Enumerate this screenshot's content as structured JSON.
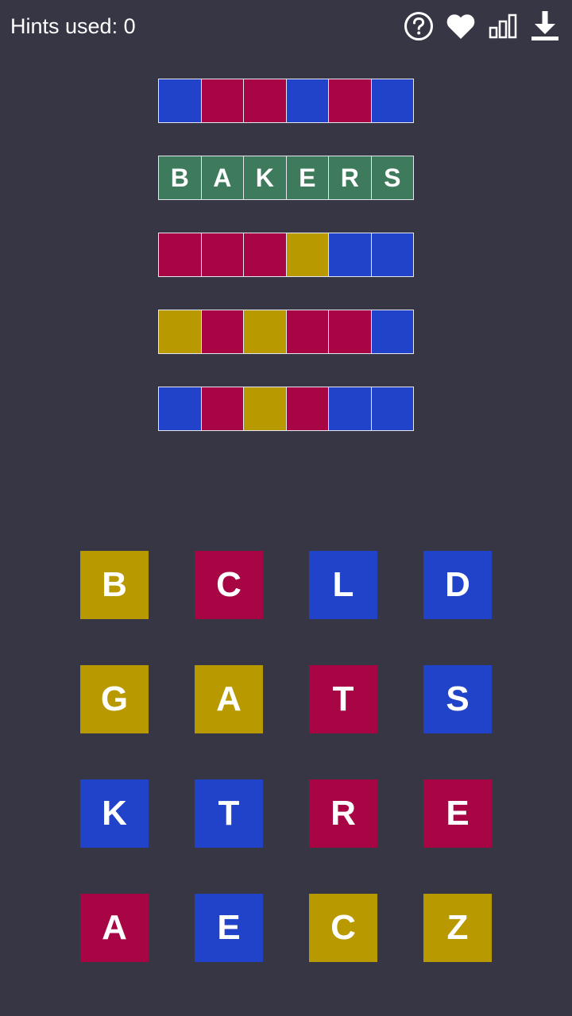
{
  "header": {
    "hints_label": "Hints used: 0",
    "icons": [
      "help-icon",
      "heart-icon",
      "stats-icon",
      "download-icon"
    ]
  },
  "colors": {
    "background": "#373645",
    "blue": "#2143c9",
    "red": "#a80545",
    "yellow": "#b89a00",
    "green": "#3e7b5d"
  },
  "guess_rows": [
    {
      "cells": [
        {
          "letter": "",
          "color": "blue"
        },
        {
          "letter": "",
          "color": "red"
        },
        {
          "letter": "",
          "color": "red"
        },
        {
          "letter": "",
          "color": "blue"
        },
        {
          "letter": "",
          "color": "red"
        },
        {
          "letter": "",
          "color": "blue"
        }
      ]
    },
    {
      "cells": [
        {
          "letter": "B",
          "color": "green"
        },
        {
          "letter": "A",
          "color": "green"
        },
        {
          "letter": "K",
          "color": "green"
        },
        {
          "letter": "E",
          "color": "green"
        },
        {
          "letter": "R",
          "color": "green"
        },
        {
          "letter": "S",
          "color": "green"
        }
      ]
    },
    {
      "cells": [
        {
          "letter": "",
          "color": "red"
        },
        {
          "letter": "",
          "color": "red"
        },
        {
          "letter": "",
          "color": "red"
        },
        {
          "letter": "",
          "color": "yellow"
        },
        {
          "letter": "",
          "color": "blue"
        },
        {
          "letter": "",
          "color": "blue"
        }
      ]
    },
    {
      "cells": [
        {
          "letter": "",
          "color": "yellow"
        },
        {
          "letter": "",
          "color": "red"
        },
        {
          "letter": "",
          "color": "yellow"
        },
        {
          "letter": "",
          "color": "red"
        },
        {
          "letter": "",
          "color": "red"
        },
        {
          "letter": "",
          "color": "blue"
        }
      ]
    },
    {
      "cells": [
        {
          "letter": "",
          "color": "blue"
        },
        {
          "letter": "",
          "color": "red"
        },
        {
          "letter": "",
          "color": "yellow"
        },
        {
          "letter": "",
          "color": "red"
        },
        {
          "letter": "",
          "color": "blue"
        },
        {
          "letter": "",
          "color": "blue"
        }
      ]
    }
  ],
  "letter_tiles": [
    {
      "letter": "B",
      "color": "yellow"
    },
    {
      "letter": "C",
      "color": "red"
    },
    {
      "letter": "L",
      "color": "blue"
    },
    {
      "letter": "D",
      "color": "blue"
    },
    {
      "letter": "G",
      "color": "yellow"
    },
    {
      "letter": "A",
      "color": "yellow"
    },
    {
      "letter": "T",
      "color": "red"
    },
    {
      "letter": "S",
      "color": "blue"
    },
    {
      "letter": "K",
      "color": "blue"
    },
    {
      "letter": "T",
      "color": "blue"
    },
    {
      "letter": "R",
      "color": "red"
    },
    {
      "letter": "E",
      "color": "red"
    },
    {
      "letter": "A",
      "color": "red"
    },
    {
      "letter": "E",
      "color": "blue"
    },
    {
      "letter": "C",
      "color": "yellow"
    },
    {
      "letter": "Z",
      "color": "yellow"
    }
  ]
}
